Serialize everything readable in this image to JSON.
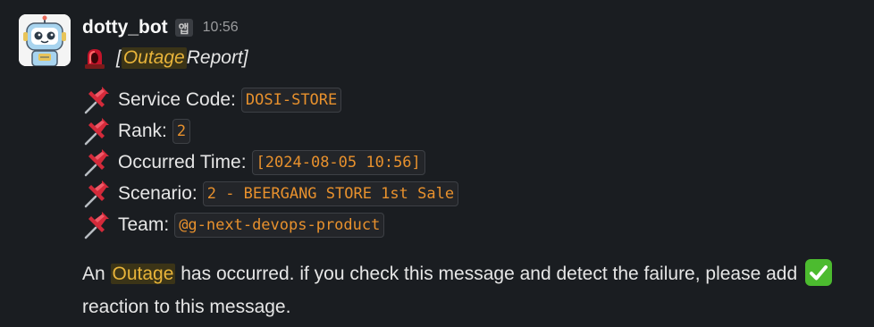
{
  "sender": {
    "name": "dotty_bot",
    "badge": "앱",
    "time": "10:56"
  },
  "title": {
    "prefix": "[",
    "highlight": "Outage",
    "suffix": " Report]"
  },
  "fields": [
    {
      "label": "Service Code:",
      "value": "DOSI-STORE"
    },
    {
      "label": "Rank:",
      "value": "2"
    },
    {
      "label": "Occurred Time:",
      "value": "[2024-08-05 10:56]"
    },
    {
      "label": "Scenario:",
      "value": "2 - BEERGANG STORE 1st Sale"
    },
    {
      "label": "Team:",
      "value": "@g-next-devops-product"
    }
  ],
  "message": {
    "part1": "An ",
    "highlight": "Outage",
    "part2": " has occurred. if you check this message and detect the failure, please add ",
    "part3": " reaction to this message."
  },
  "icons": {
    "avatar": "robot-avatar",
    "siren": "siren-icon",
    "pin": "pushpin-icon",
    "check": "white-check-mark-icon"
  },
  "colors": {
    "background": "#1a1d21",
    "highlight": "#e8b43a",
    "code": "#e8912d"
  }
}
